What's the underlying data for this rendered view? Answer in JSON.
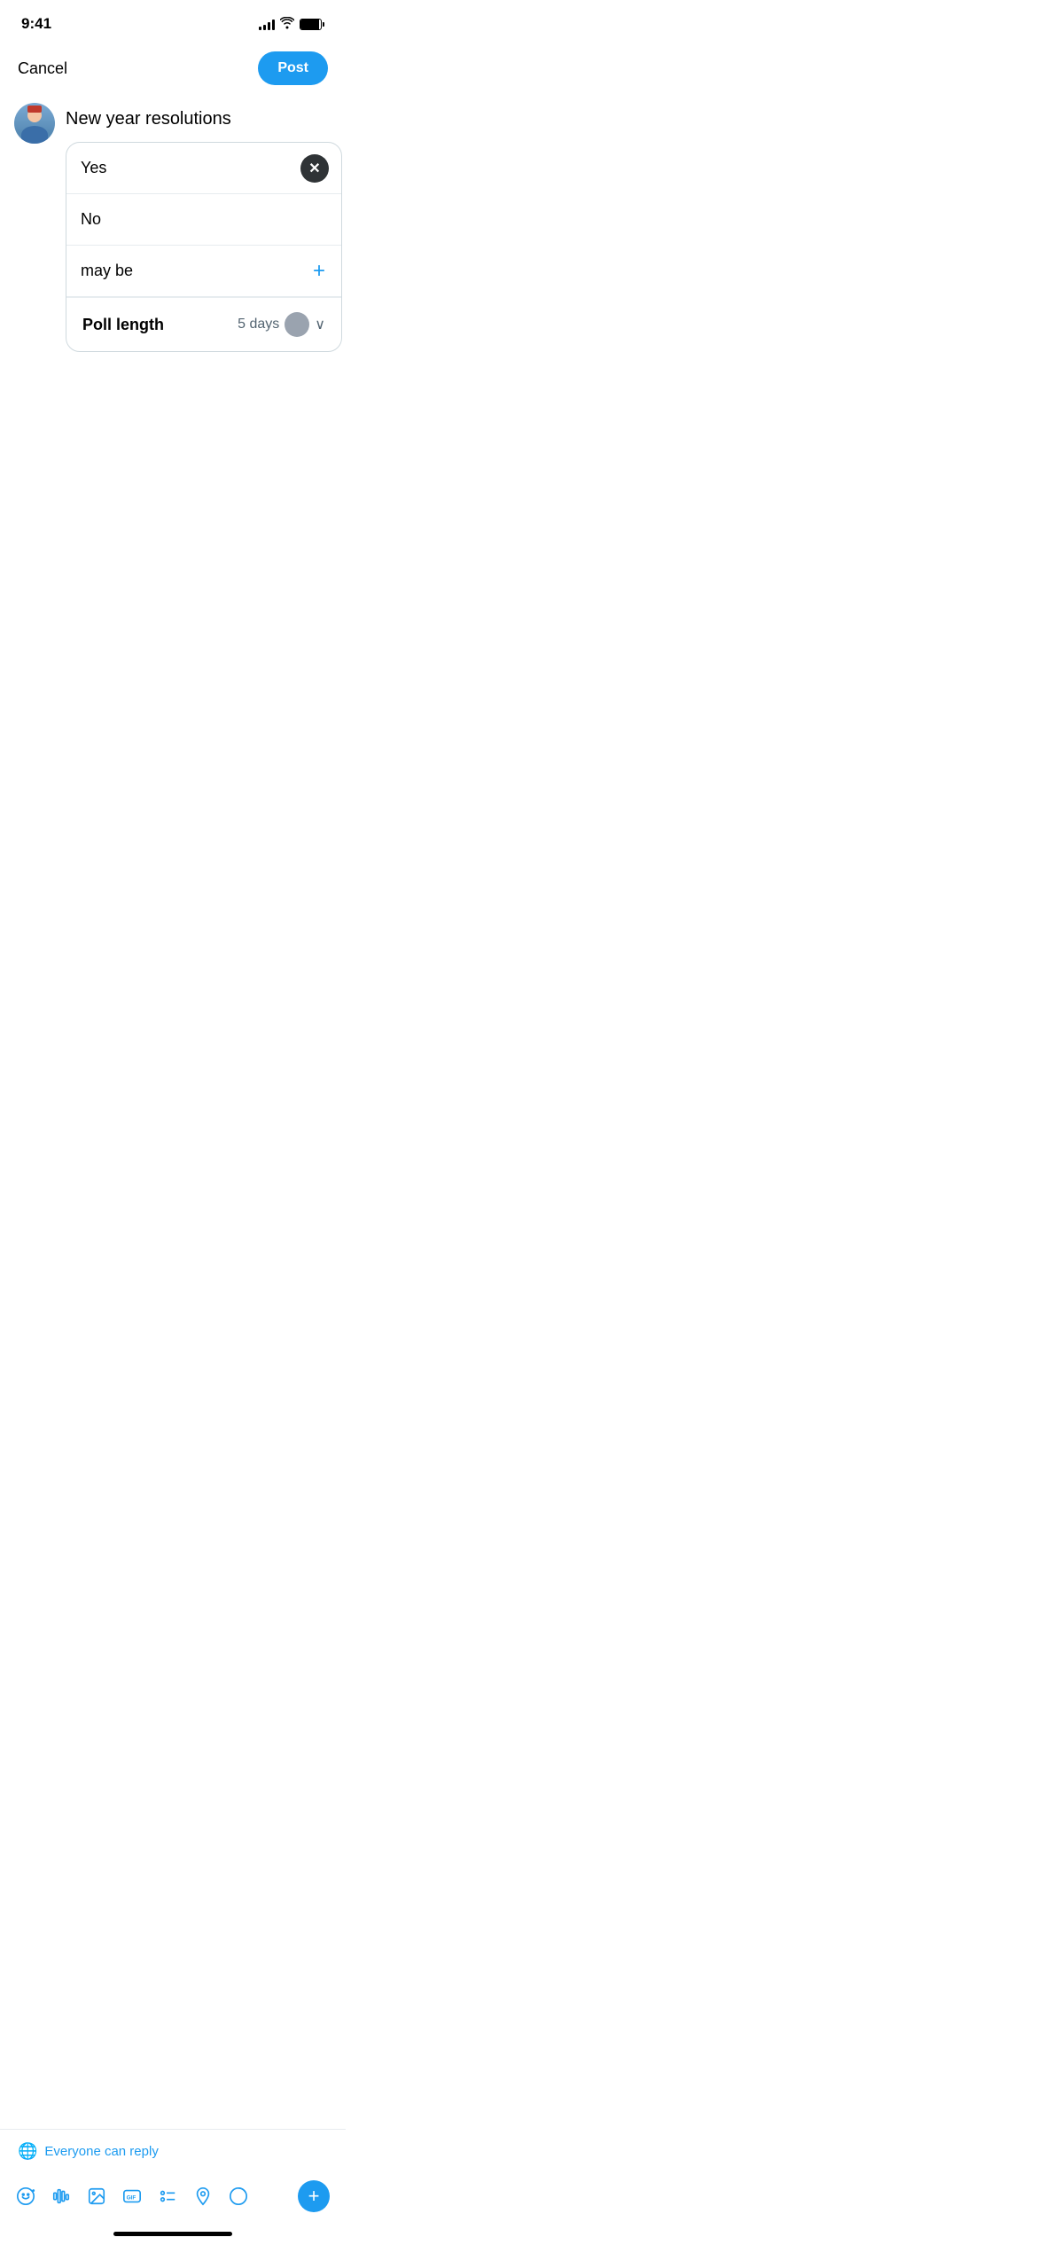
{
  "statusBar": {
    "time": "9:41"
  },
  "nav": {
    "cancelLabel": "Cancel",
    "postLabel": "Post"
  },
  "compose": {
    "tweetText": "New year resolutions"
  },
  "poll": {
    "option1": "Yes",
    "option2": "No",
    "option3": "may be",
    "pollLengthLabel": "Poll length",
    "pollLengthValue": "5 days"
  },
  "bottomBar": {
    "replyText": "Everyone can reply"
  },
  "toolbar": {
    "icons": [
      "emoji-plus-icon",
      "audio-icon",
      "image-icon",
      "gif-icon",
      "list-icon",
      "location-icon",
      "circle-icon"
    ],
    "addLabel": "+"
  }
}
